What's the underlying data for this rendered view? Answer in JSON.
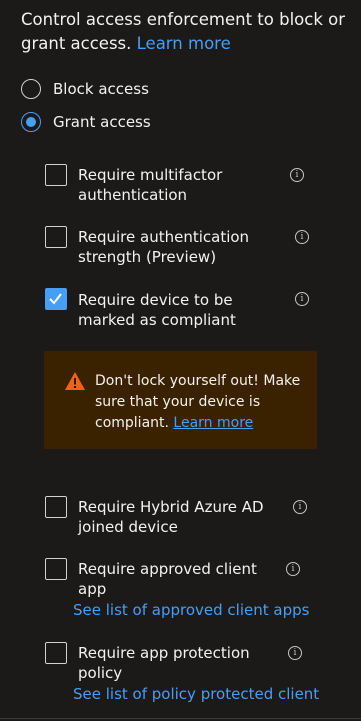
{
  "intro": {
    "text": "Control access enforcement to block or grant access.",
    "learn_more": "Learn more"
  },
  "access_mode": {
    "block_label": "Block access",
    "grant_label": "Grant access",
    "selected": "grant"
  },
  "options": {
    "mfa": {
      "label": "Require multifactor authentication",
      "checked": false
    },
    "auth_strength": {
      "label": "Require authentication strength (Preview)",
      "checked": false
    },
    "compliant": {
      "label": "Require device to be marked as compliant",
      "checked": true
    },
    "hybrid": {
      "label": "Require Hybrid Azure AD joined device",
      "checked": false
    },
    "approved_app": {
      "label": "Require approved client app",
      "checked": false,
      "link": "See list of approved client apps"
    },
    "app_protection": {
      "label": "Require app protection policy",
      "checked": false,
      "link": "See list of policy protected client"
    }
  },
  "warning": {
    "text": "Don't lock yourself out! Make sure that your device is compliant.",
    "learn_more": "Learn more"
  },
  "colors": {
    "accent": "#479ef5",
    "warning_bg": "#3a2100",
    "warning_icon": "#f7630c",
    "background": "#1b1a19"
  },
  "icons": {
    "info": "info-icon",
    "warning": "warning-triangle-icon",
    "check": "checkmark-icon"
  }
}
